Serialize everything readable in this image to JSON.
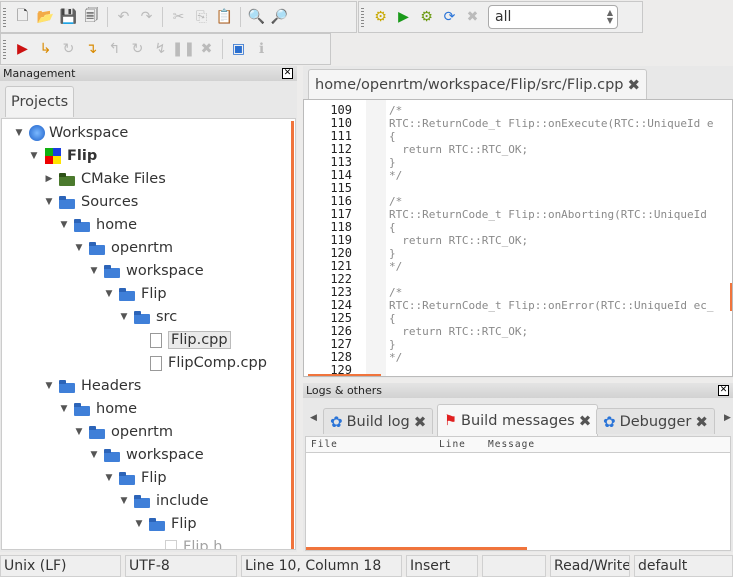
{
  "toolbar": {
    "target_select": "all",
    "main_icons": [
      "new-file-icon",
      "open-icon",
      "save-icon",
      "save-all-icon",
      "undo-icon",
      "redo-icon",
      "cut-icon",
      "copy-icon",
      "paste-icon",
      "find-icon",
      "replace-icon"
    ],
    "build_icons": [
      "build-icon",
      "run-icon",
      "build-run-icon",
      "rebuild-icon",
      "abort-icon"
    ],
    "debug_icons": [
      "debug-run-icon",
      "run-to-cursor-icon",
      "next-line-icon",
      "step-into-icon",
      "step-out-icon",
      "next-instruction-icon",
      "step-instruction-icon",
      "pause-icon",
      "stop-icon",
      "debug-windows-icon",
      "info-icon"
    ]
  },
  "management": {
    "title": "Management",
    "tab": "Projects",
    "tree": [
      {
        "label": "Workspace",
        "level": 0,
        "icon": "workspace",
        "expanded": true
      },
      {
        "label": "Flip",
        "level": 1,
        "icon": "project",
        "expanded": true,
        "bold": true
      },
      {
        "label": "CMake Files",
        "level": 2,
        "icon": "folder-green",
        "expanded": false
      },
      {
        "label": "Sources",
        "level": 2,
        "icon": "folder",
        "expanded": true
      },
      {
        "label": "home",
        "level": 3,
        "icon": "folder",
        "expanded": true
      },
      {
        "label": "openrtm",
        "level": 4,
        "icon": "folder",
        "expanded": true
      },
      {
        "label": "workspace",
        "level": 5,
        "icon": "folder",
        "expanded": true
      },
      {
        "label": "Flip",
        "level": 6,
        "icon": "folder",
        "expanded": true
      },
      {
        "label": "src",
        "level": 7,
        "icon": "folder",
        "expanded": true
      },
      {
        "label": "Flip.cpp",
        "level": 8,
        "icon": "file",
        "selected": true
      },
      {
        "label": "FlipComp.cpp",
        "level": 8,
        "icon": "file"
      },
      {
        "label": "Headers",
        "level": 2,
        "icon": "folder",
        "expanded": true
      },
      {
        "label": "home",
        "level": 3,
        "icon": "folder",
        "expanded": true
      },
      {
        "label": "openrtm",
        "level": 4,
        "icon": "folder",
        "expanded": true
      },
      {
        "label": "workspace",
        "level": 5,
        "icon": "folder",
        "expanded": true
      },
      {
        "label": "Flip",
        "level": 6,
        "icon": "folder",
        "expanded": true
      },
      {
        "label": "include",
        "level": 7,
        "icon": "folder",
        "expanded": true
      },
      {
        "label": "Flip",
        "level": 8,
        "icon": "folder",
        "expanded": true
      },
      {
        "label": "Flip.h",
        "level": 9,
        "icon": "file",
        "faded": true
      }
    ]
  },
  "editor": {
    "tab": "home/openrtm/workspace/Flip/src/Flip.cpp",
    "lines": [
      {
        "n": "109",
        "text": "/*"
      },
      {
        "n": "110",
        "text": "RTC::ReturnCode_t Flip::onExecute(RTC::UniqueId e"
      },
      {
        "n": "111",
        "text": "{"
      },
      {
        "n": "112",
        "text": "  return RTC::RTC_OK;"
      },
      {
        "n": "113",
        "text": "}"
      },
      {
        "n": "114",
        "text": "*/"
      },
      {
        "n": "115",
        "text": ""
      },
      {
        "n": "116",
        "text": "/*"
      },
      {
        "n": "117",
        "text": "RTC::ReturnCode_t Flip::onAborting(RTC::UniqueId "
      },
      {
        "n": "118",
        "text": "{"
      },
      {
        "n": "119",
        "text": "  return RTC::RTC_OK;"
      },
      {
        "n": "120",
        "text": "}"
      },
      {
        "n": "121",
        "text": "*/"
      },
      {
        "n": "122",
        "text": ""
      },
      {
        "n": "123",
        "text": "/*"
      },
      {
        "n": "124",
        "text": "RTC::ReturnCode_t Flip::onError(RTC::UniqueId ec_"
      },
      {
        "n": "125",
        "text": "{"
      },
      {
        "n": "126",
        "text": "  return RTC::RTC_OK;"
      },
      {
        "n": "127",
        "text": "}"
      },
      {
        "n": "128",
        "text": "*/"
      },
      {
        "n": "129",
        "text": ""
      }
    ]
  },
  "logs": {
    "title": "Logs & others",
    "tabs": [
      "Build log",
      "Build messages",
      "Debugger"
    ],
    "active_tab": "Build messages",
    "columns": [
      "File",
      "Line",
      "Message"
    ]
  },
  "status": [
    "Unix (LF)",
    "UTF-8",
    "Line 10, Column 18",
    "Insert",
    "",
    "Read/Write",
    "default"
  ],
  "colors": {
    "accent": "#f0743c",
    "folder": "#3f7fd8"
  }
}
